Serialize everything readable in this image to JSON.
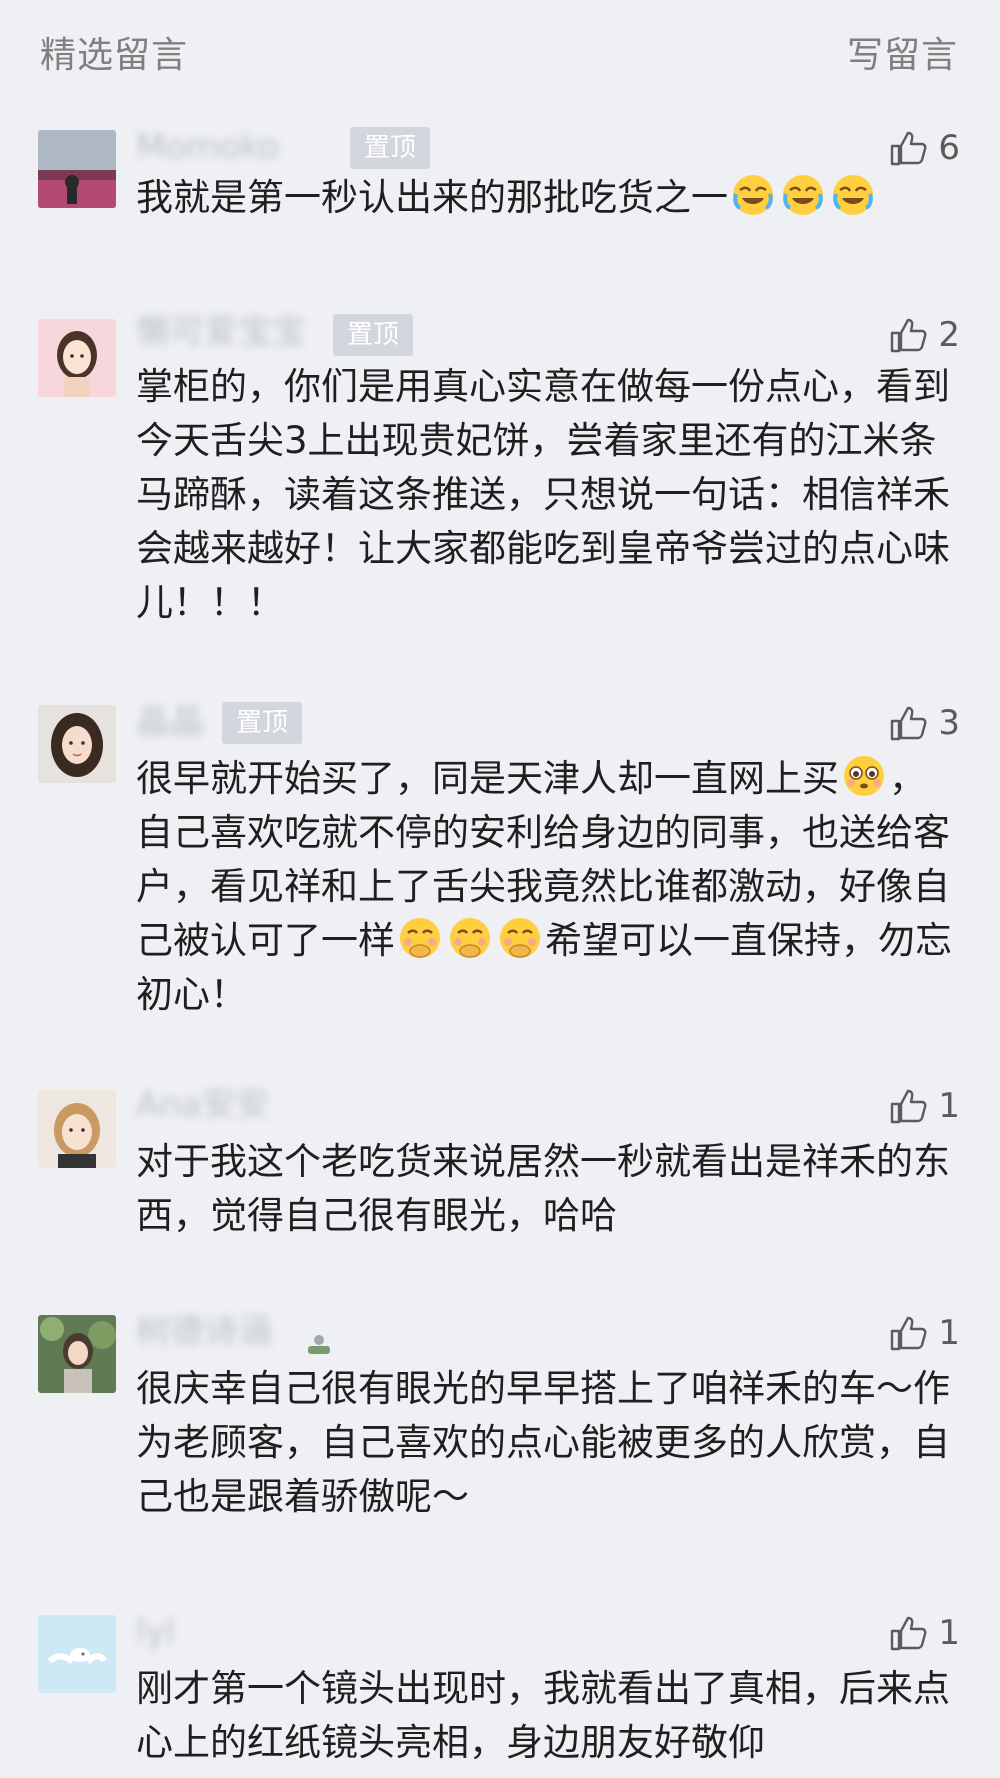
{
  "header": {
    "title": "精选留言",
    "write_label": "写留言"
  },
  "badge_label": "置顶",
  "comments": [
    {
      "name": "Momoko",
      "pinned": true,
      "likes": "6",
      "text_parts": [
        "我就是第一秒认出来的那批吃货之一"
      ],
      "emoji": "laugh-cry"
    },
    {
      "name": "懒可爱宝宝",
      "pinned": true,
      "likes": "2",
      "text": "掌柜的，你们是用真心实意在做每一份点心，看到今天舌尖3上出现贵妃饼，尝着家里还有的江米条马蹄酥，读着这条推送，只想说一句话：相信祥禾会越来越好！让大家都能吃到皇帝爷尝过的点心味儿！！！"
    },
    {
      "name": "晶晶",
      "pinned": true,
      "likes": "3",
      "part1": "很早就开始买了，同是天津人却一直网上买",
      "part2": "，自己喜欢吃就不停的安利给身边的同事，也送给客户，看见祥和上了舌尖我竟然比谁都激动，好像自己被认可了一样",
      "part3": "希望可以一直保持，勿忘初心！"
    },
    {
      "name": "Ana安安",
      "pinned": false,
      "likes": "1",
      "text": "对于我这个老吃货来说居然一秒就看出是祥禾的东西，觉得自己很有眼光，哈哈"
    },
    {
      "name": "树德诗涵",
      "pinned": false,
      "likes": "1",
      "text": "很庆幸自己很有眼光的早早搭上了咱祥禾的车～作为老顾客，自己喜欢的点心能被更多的人欣赏，自己也是跟着骄傲呢～"
    },
    {
      "name": "lyl",
      "pinned": false,
      "likes": "1",
      "text": "刚才第一个镜头出现时，我就看出了真相，后来点心上的红纸镜头亮相，身边朋友好敬仰"
    }
  ]
}
